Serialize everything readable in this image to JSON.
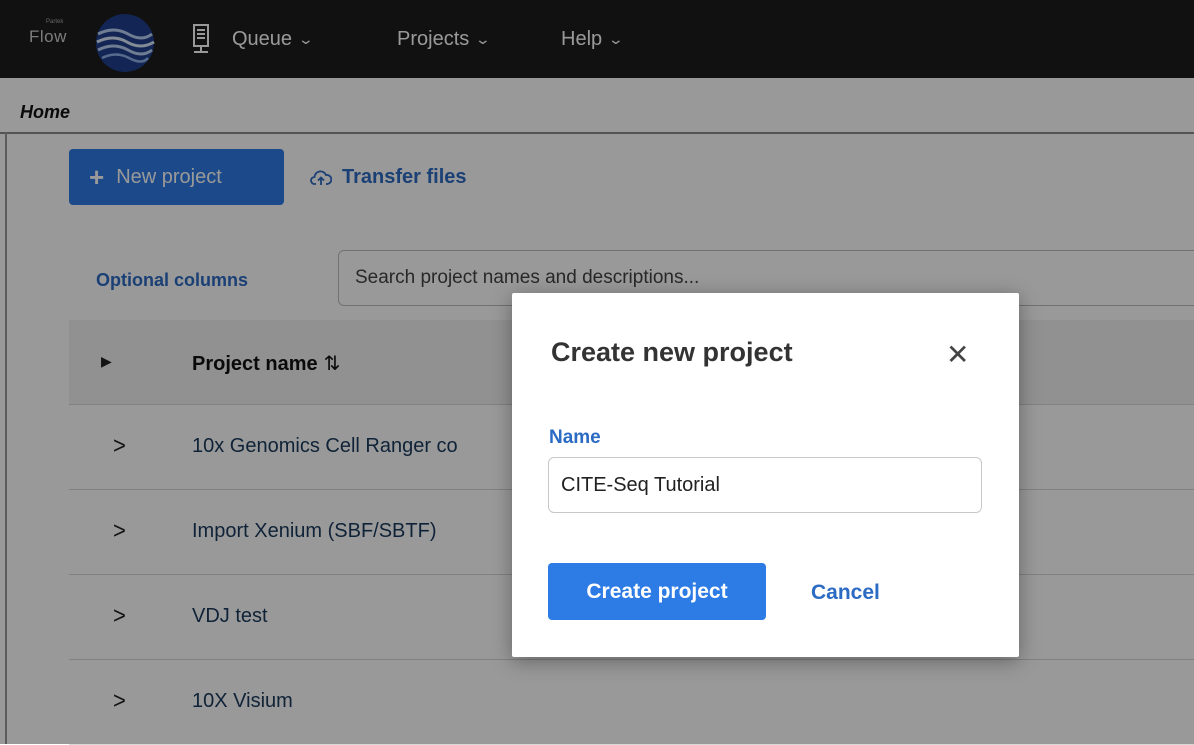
{
  "app": {
    "logo_small": "Partek",
    "logo_text": "Flow",
    "nav": [
      {
        "label": "Queue"
      },
      {
        "label": "Projects"
      },
      {
        "label": "Help"
      }
    ]
  },
  "breadcrumb": {
    "home": "Home"
  },
  "toolbar": {
    "new_project": "New project",
    "transfer_files": "Transfer files"
  },
  "list": {
    "optional_columns": "Optional columns",
    "search_placeholder": "Search project names and descriptions...",
    "header_name": "Project name",
    "rows": [
      {
        "name": "10x Genomics Cell Ranger co"
      },
      {
        "name": "Import Xenium (SBF/SBTF)"
      },
      {
        "name": "VDJ test"
      },
      {
        "name": "10X Visium"
      }
    ]
  },
  "modal": {
    "title": "Create new project",
    "name_label": "Name",
    "name_value": "CITE-Seq Tutorial",
    "create_label": "Create project",
    "cancel_label": "Cancel"
  },
  "colors": {
    "accent": "#2d7be5",
    "link": "#2c6bc4",
    "topbar": "#1d1d1d"
  },
  "icons": {
    "logo": "wave-globe-icon",
    "queue": "server-icon",
    "chevron": "chevron-down-icon",
    "transfer": "cloud-upload-icon",
    "close": "close-icon",
    "expand": "chevron-right-icon",
    "sort": "sort-icon"
  }
}
